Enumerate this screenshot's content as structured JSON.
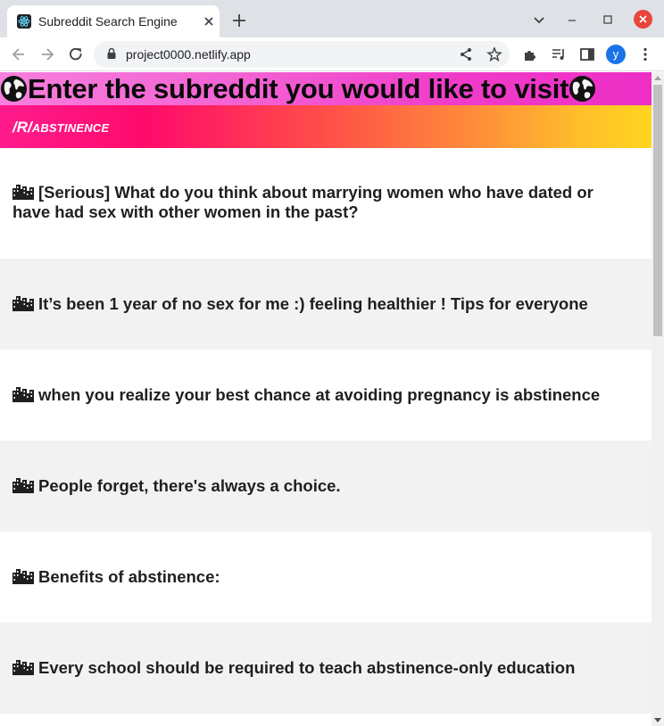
{
  "browser": {
    "tab_title": "Subreddit Search Engine",
    "url": "project0000.netlify.app",
    "avatar_letter": "y"
  },
  "page": {
    "heading": "Enter the subreddit you would like to visit",
    "subreddit_prefix": "/R/",
    "subreddit_name": "ABSTINENCE",
    "posts": [
      {
        "title": "[Serious] What do you think about marrying women who have dated or have had sex with other women in the past?"
      },
      {
        "title": "It’s been 1 year of no sex for me :) feeling healthier ! Tips for everyone"
      },
      {
        "title": "when you realize your best chance at avoiding pregnancy is abstinence"
      },
      {
        "title": "People forget, there's always a choice."
      },
      {
        "title": "Benefits of abstinence:"
      },
      {
        "title": "Every school should be required to teach abstinence-only education"
      }
    ]
  },
  "colors": {
    "hero_gradient": [
      "#f77fdd",
      "#ee2fc6"
    ],
    "subbar_gradient": [
      "#ff1b8d",
      "#ff4a4a",
      "#ffd51e"
    ],
    "row_alt": "#f2f2f2"
  },
  "icons": {
    "heading_icon": "globe-icon",
    "post_icon": "cityscape-icon"
  }
}
